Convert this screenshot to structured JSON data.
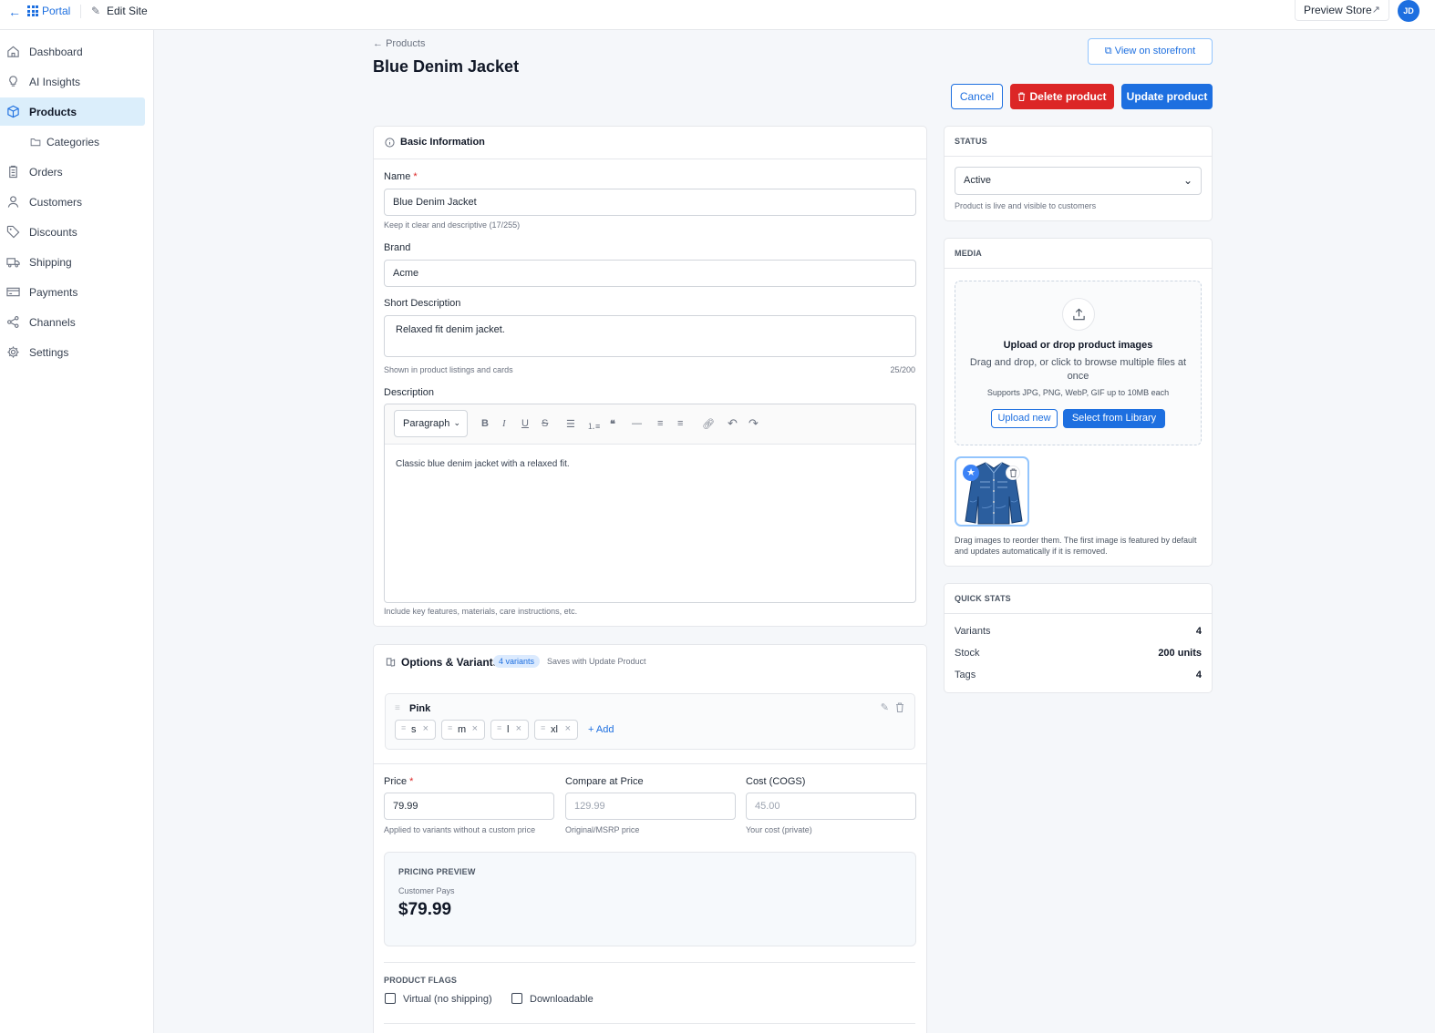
{
  "topbar": {
    "portal_label": "Portal",
    "edit_site_label": "Edit Site",
    "preview_store_label": "Preview Store",
    "avatar_initials": "JD"
  },
  "sidebar": {
    "items": [
      {
        "label": "Dashboard",
        "icon": "home-icon"
      },
      {
        "label": "AI Insights",
        "icon": "lightbulb-icon"
      },
      {
        "label": "Products",
        "icon": "box-icon",
        "active": true
      },
      {
        "label": "Categories",
        "icon": "folder-icon",
        "sub": true
      },
      {
        "label": "Orders",
        "icon": "clipboard-icon"
      },
      {
        "label": "Customers",
        "icon": "user-icon"
      },
      {
        "label": "Discounts",
        "icon": "tag-icon"
      },
      {
        "label": "Shipping",
        "icon": "truck-icon"
      },
      {
        "label": "Payments",
        "icon": "credit-card-icon"
      },
      {
        "label": "Channels",
        "icon": "share-icon"
      },
      {
        "label": "Settings",
        "icon": "gear-icon"
      }
    ]
  },
  "header": {
    "breadcrumb": "Products",
    "title": "Blue Denim Jacket",
    "view_storefront": "View on storefront",
    "cancel": "Cancel",
    "delete": "Delete product",
    "update": "Update product"
  },
  "basic": {
    "section_title": "Basic Information",
    "name_label": "Name",
    "name_value": "Blue Denim Jacket",
    "name_hint": "Keep it clear and descriptive (17/255)",
    "brand_label": "Brand",
    "brand_value": "Acme",
    "short_label": "Short Description",
    "short_value": "Relaxed fit denim jacket.",
    "short_hint": "Shown in product listings and cards",
    "short_count": "25/200",
    "desc_label": "Description",
    "desc_format": "Paragraph",
    "desc_value": "Classic blue denim jacket with a relaxed fit.",
    "desc_hint": "Include key features, materials, care instructions, etc."
  },
  "variants": {
    "section_title": "Options & Variants",
    "badge": "4 variants",
    "note": "Saves with Update Product",
    "option_name": "Pink",
    "values": [
      "s",
      "m",
      "l",
      "xl"
    ],
    "add_label": "+ Add"
  },
  "pricing": {
    "price_label": "Price",
    "price_value": "79.99",
    "price_hint": "Applied to variants without a custom price",
    "compare_label": "Compare at Price",
    "compare_placeholder": "129.99",
    "compare_hint": "Original/MSRP price",
    "cost_label": "Cost (COGS)",
    "cost_placeholder": "45.00",
    "cost_hint": "Your cost (private)",
    "preview_title": "PRICING PREVIEW",
    "preview_sub": "Customer Pays",
    "preview_amount": "$79.99"
  },
  "flags": {
    "title": "PRODUCT FLAGS",
    "virtual_label": "Virtual (no shipping)",
    "downloadable_label": "Downloadable"
  },
  "status": {
    "title": "STATUS",
    "value": "Active",
    "hint": "Product is live and visible to customers"
  },
  "media": {
    "title": "MEDIA",
    "upload_title": "Upload or drop product images",
    "upload_desc": "Drag and drop, or click to browse multiple files at once",
    "upload_support": "Supports JPG, PNG, WebP, GIF up to 10MB each",
    "upload_new": "Upload new",
    "select_library": "Select from Library",
    "reorder_hint": "Drag images to reorder them. The first image is featured by default and updates automatically if it is removed."
  },
  "stats": {
    "title": "QUICK STATS",
    "rows": [
      {
        "label": "Variants",
        "value": "4"
      },
      {
        "label": "Stock",
        "value": "200 units"
      },
      {
        "label": "Tags",
        "value": "4"
      }
    ]
  },
  "colors": {
    "accent": "#1d6fe0",
    "danger": "#dc2626",
    "active_bg": "#dbeefb"
  }
}
